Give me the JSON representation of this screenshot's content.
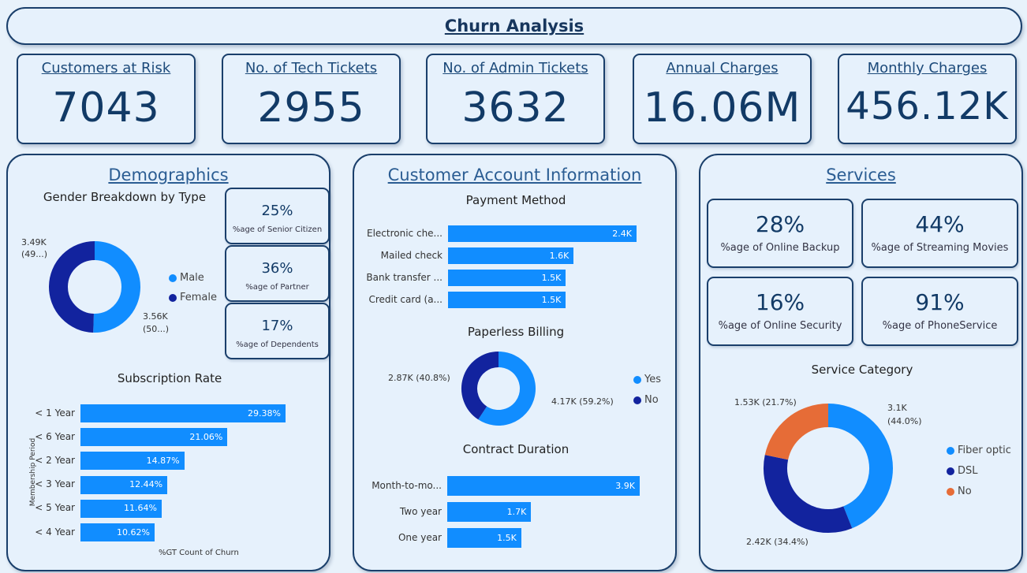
{
  "title": "Churn Analysis",
  "kpis": [
    {
      "label": "Customers at Risk",
      "value": "7043"
    },
    {
      "label": "No. of Tech Tickets",
      "value": "2955"
    },
    {
      "label": "No. of Admin Tickets",
      "value": "3632"
    },
    {
      "label": "Annual Charges",
      "value": "16.06M"
    },
    {
      "label": "Monthly Charges",
      "value": "456.12K"
    }
  ],
  "demographics": {
    "title": "Demographics",
    "gender": {
      "title": "Gender Breakdown by Type",
      "female_label": "3.49K",
      "female_label2": "(49...)",
      "male_label": "3.56K",
      "male_label2": "(50...)",
      "legend": [
        "Male",
        "Female"
      ]
    },
    "cards": [
      {
        "pct": "25%",
        "caption": "%age of Senior Citizen"
      },
      {
        "pct": "36%",
        "caption": "%age of Partner"
      },
      {
        "pct": "17%",
        "caption": "%age of Dependents"
      }
    ],
    "subscription": {
      "title": "Subscription Rate",
      "ylabel": "Membership Period",
      "xlabel": "%GT Count of Churn"
    }
  },
  "account": {
    "title": "Customer Account Information",
    "payment_title": "Payment Method",
    "paperless_title": "Paperless Billing",
    "paperless_no_label": "2.87K (40.8%)",
    "paperless_yes_label": "4.17K (59.2%)",
    "paperless_legend": [
      "Yes",
      "No"
    ],
    "contract_title": "Contract Duration"
  },
  "services": {
    "title": "Services",
    "cards": [
      {
        "pct": "28%",
        "caption": "%age of Online Backup"
      },
      {
        "pct": "44%",
        "caption": "%age of Streaming Movies"
      },
      {
        "pct": "16%",
        "caption": "%age of Online Security"
      },
      {
        "pct": "91%",
        "caption": "%age of PhoneService"
      }
    ],
    "category_title": "Service Category",
    "no_label": "1.53K (21.7%)",
    "fiber_label": "3.1K",
    "fiber_label2": "(44.0%)",
    "dsl_label": "2.42K (34.4%)",
    "legend": [
      "Fiber optic",
      "DSL",
      "No"
    ]
  },
  "colors": {
    "bar": "#118dff",
    "male": "#118dff",
    "female": "#12239e",
    "no": "#e66c37"
  },
  "chart_data": [
    {
      "type": "pie",
      "title": "Gender Breakdown by Type",
      "categories": [
        "Male",
        "Female"
      ],
      "values": [
        3560,
        3490
      ]
    },
    {
      "type": "bar",
      "title": "Subscription Rate",
      "xlabel": "%GT Count of Churn",
      "ylabel": "Membership Period",
      "categories": [
        "< 1 Year",
        "< 6 Year",
        "< 2 Year",
        "< 3 Year",
        "< 5 Year",
        "< 4 Year"
      ],
      "values": [
        29.38,
        21.06,
        14.87,
        12.44,
        11.64,
        10.62
      ],
      "labels": [
        "29.38%",
        "21.06%",
        "14.87%",
        "12.44%",
        "11.64%",
        "10.62%"
      ]
    },
    {
      "type": "bar",
      "title": "Payment Method",
      "categories": [
        "Electronic che...",
        "Mailed check",
        "Bank transfer ...",
        "Credit card (a..."
      ],
      "values": [
        2.4,
        1.6,
        1.5,
        1.5
      ],
      "labels": [
        "2.4K",
        "1.6K",
        "1.5K",
        "1.5K"
      ]
    },
    {
      "type": "pie",
      "title": "Paperless Billing",
      "categories": [
        "Yes",
        "No"
      ],
      "values": [
        4170,
        2870
      ]
    },
    {
      "type": "bar",
      "title": "Contract Duration",
      "categories": [
        "Month-to-mo...",
        "Two year",
        "One year"
      ],
      "values": [
        3.9,
        1.7,
        1.5
      ],
      "labels": [
        "3.9K",
        "1.7K",
        "1.5K"
      ]
    },
    {
      "type": "pie",
      "title": "Service Category",
      "categories": [
        "Fiber optic",
        "DSL",
        "No"
      ],
      "values": [
        3100,
        2420,
        1530
      ]
    }
  ]
}
